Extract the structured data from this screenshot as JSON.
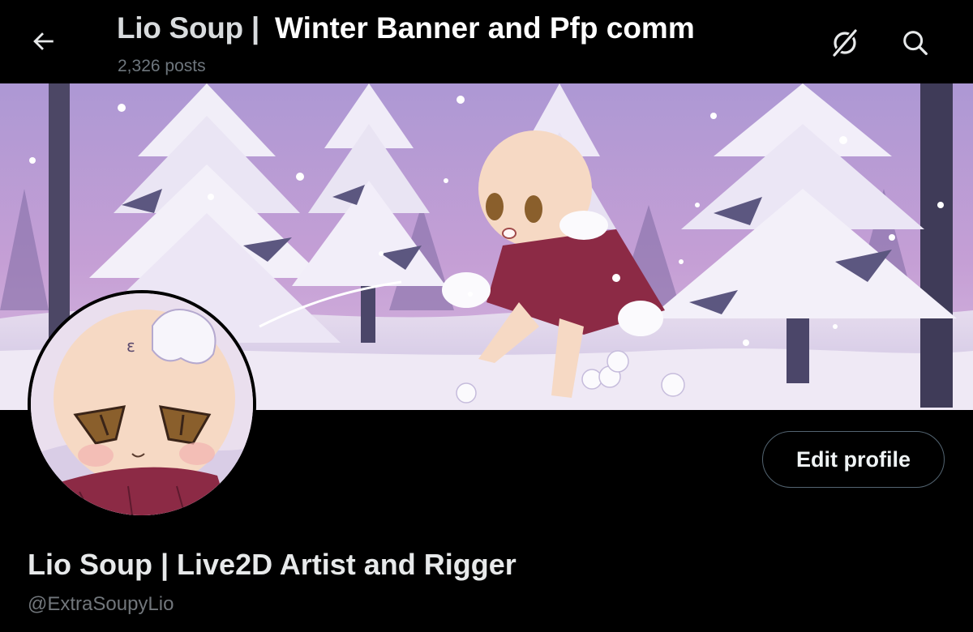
{
  "header": {
    "profile_name": "Lio Soup |",
    "overlay_title": "Winter Banner and Pfp comm",
    "posts_count": "2,326 posts",
    "back_icon": "arrow-left-icon",
    "grok_icon": "grok-icon",
    "search_icon": "search-icon"
  },
  "banner": {
    "sky_top": "#b69ed4",
    "sky_bottom": "#c9a1d6",
    "snow": "#f4f1f8",
    "tree_shadow": "#5a5475",
    "skin": "#f6d9c4",
    "cape": "#8c2a45"
  },
  "profile": {
    "display_name": "Lio Soup | Live2D Artist and Rigger",
    "handle": "@ExtraSoupyLio",
    "edit_profile_label": "Edit profile",
    "border_color": "#536471"
  }
}
